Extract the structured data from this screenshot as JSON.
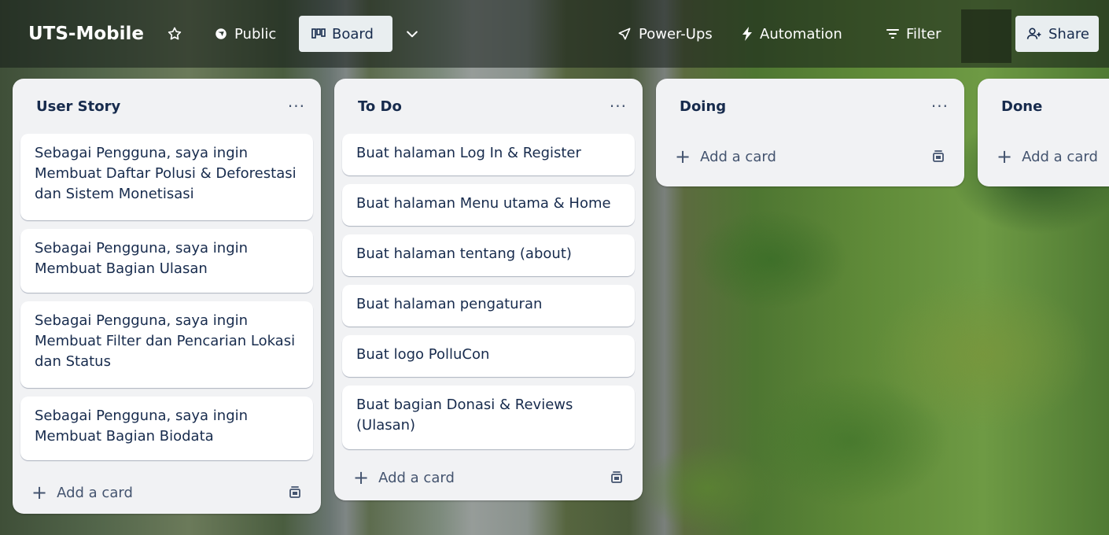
{
  "topbar": {
    "board_name": "UTS-Mobile",
    "star_icon": "star-icon",
    "visibility_label": "Public",
    "view_label": "Board",
    "powerups_label": "Power-Ups",
    "automation_label": "Automation",
    "filter_label": "Filter",
    "share_label": "Share"
  },
  "lists": [
    {
      "title": "User Story",
      "menu": "···",
      "cards": [
        "Sebagai Pengguna, saya ingin Membuat Daftar Polusi & Deforestasi dan Sistem Monetisasi",
        "Sebagai Pengguna, saya ingin Membuat Bagian Ulasan",
        "Sebagai Pengguna, saya ingin Membuat Filter dan Pencarian Lokasi dan Status",
        "Sebagai Pengguna, saya ingin Membuat Bagian Biodata"
      ],
      "add_card_label": "Add a card"
    },
    {
      "title": "To Do",
      "menu": "···",
      "cards": [
        "Buat halaman Log In & Register",
        "Buat halaman Menu utama & Home",
        "Buat halaman tentang (about)",
        "Buat halaman pengaturan",
        "Buat logo PolluCon",
        "Buat bagian Donasi & Reviews (Ulasan)"
      ],
      "add_card_label": "Add a card"
    },
    {
      "title": "Doing",
      "menu": "···",
      "cards": [],
      "add_card_label": "Add a card"
    },
    {
      "title": "Done",
      "menu": "···",
      "cards": [],
      "add_card_label": "Add a card"
    }
  ]
}
